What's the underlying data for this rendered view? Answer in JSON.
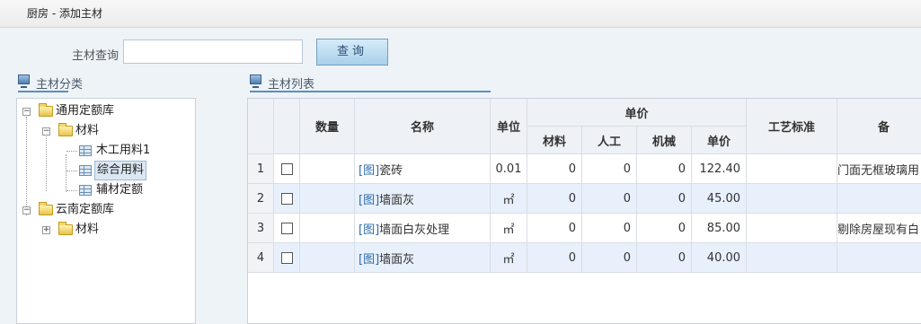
{
  "header": {
    "title": "厨房 - 添加主材"
  },
  "search": {
    "label": "主材查询",
    "value": "",
    "button": "查询"
  },
  "left_panel": {
    "title": "主材分类",
    "tree": [
      {
        "label": "通用定额库",
        "toggle": "−"
      },
      {
        "label": "材料",
        "toggle": "−"
      },
      {
        "label": "木工用料1"
      },
      {
        "label": "综合用料",
        "selected": true
      },
      {
        "label": "辅材定额"
      },
      {
        "label": "云南定额库",
        "toggle": "−"
      },
      {
        "label": "材料",
        "toggle": "+"
      }
    ]
  },
  "right_panel": {
    "title": "主材列表",
    "columns": {
      "qty": "数量",
      "name": "名称",
      "unit": "单位",
      "price_group": "单价",
      "material": "材料",
      "labor": "人工",
      "machine": "机械",
      "unit_price": "单价",
      "standard": "工艺标准",
      "remark": "备"
    },
    "rows": [
      {
        "no": "1",
        "link": "[图]",
        "name": "瓷砖",
        "unit": "0.01",
        "material": "0",
        "labor": "0",
        "machine": "0",
        "unit_price": "122.40",
        "standard": "",
        "remark": "门面无框玻璃用"
      },
      {
        "no": "2",
        "link": "[图]",
        "name": "墙面灰",
        "unit": "㎡",
        "material": "0",
        "labor": "0",
        "machine": "0",
        "unit_price": "45.00",
        "standard": "",
        "remark": ""
      },
      {
        "no": "3",
        "link": "[图]",
        "name": "墙面白灰处理",
        "unit": "㎡",
        "material": "0",
        "labor": "0",
        "machine": "0",
        "unit_price": "85.00",
        "standard": "",
        "remark": "剔除房屋现有白"
      },
      {
        "no": "4",
        "link": "[图]",
        "name": "墙面灰",
        "unit": "㎡",
        "material": "0",
        "labor": "0",
        "machine": "0",
        "unit_price": "40.00",
        "standard": "",
        "remark": ""
      }
    ]
  }
}
